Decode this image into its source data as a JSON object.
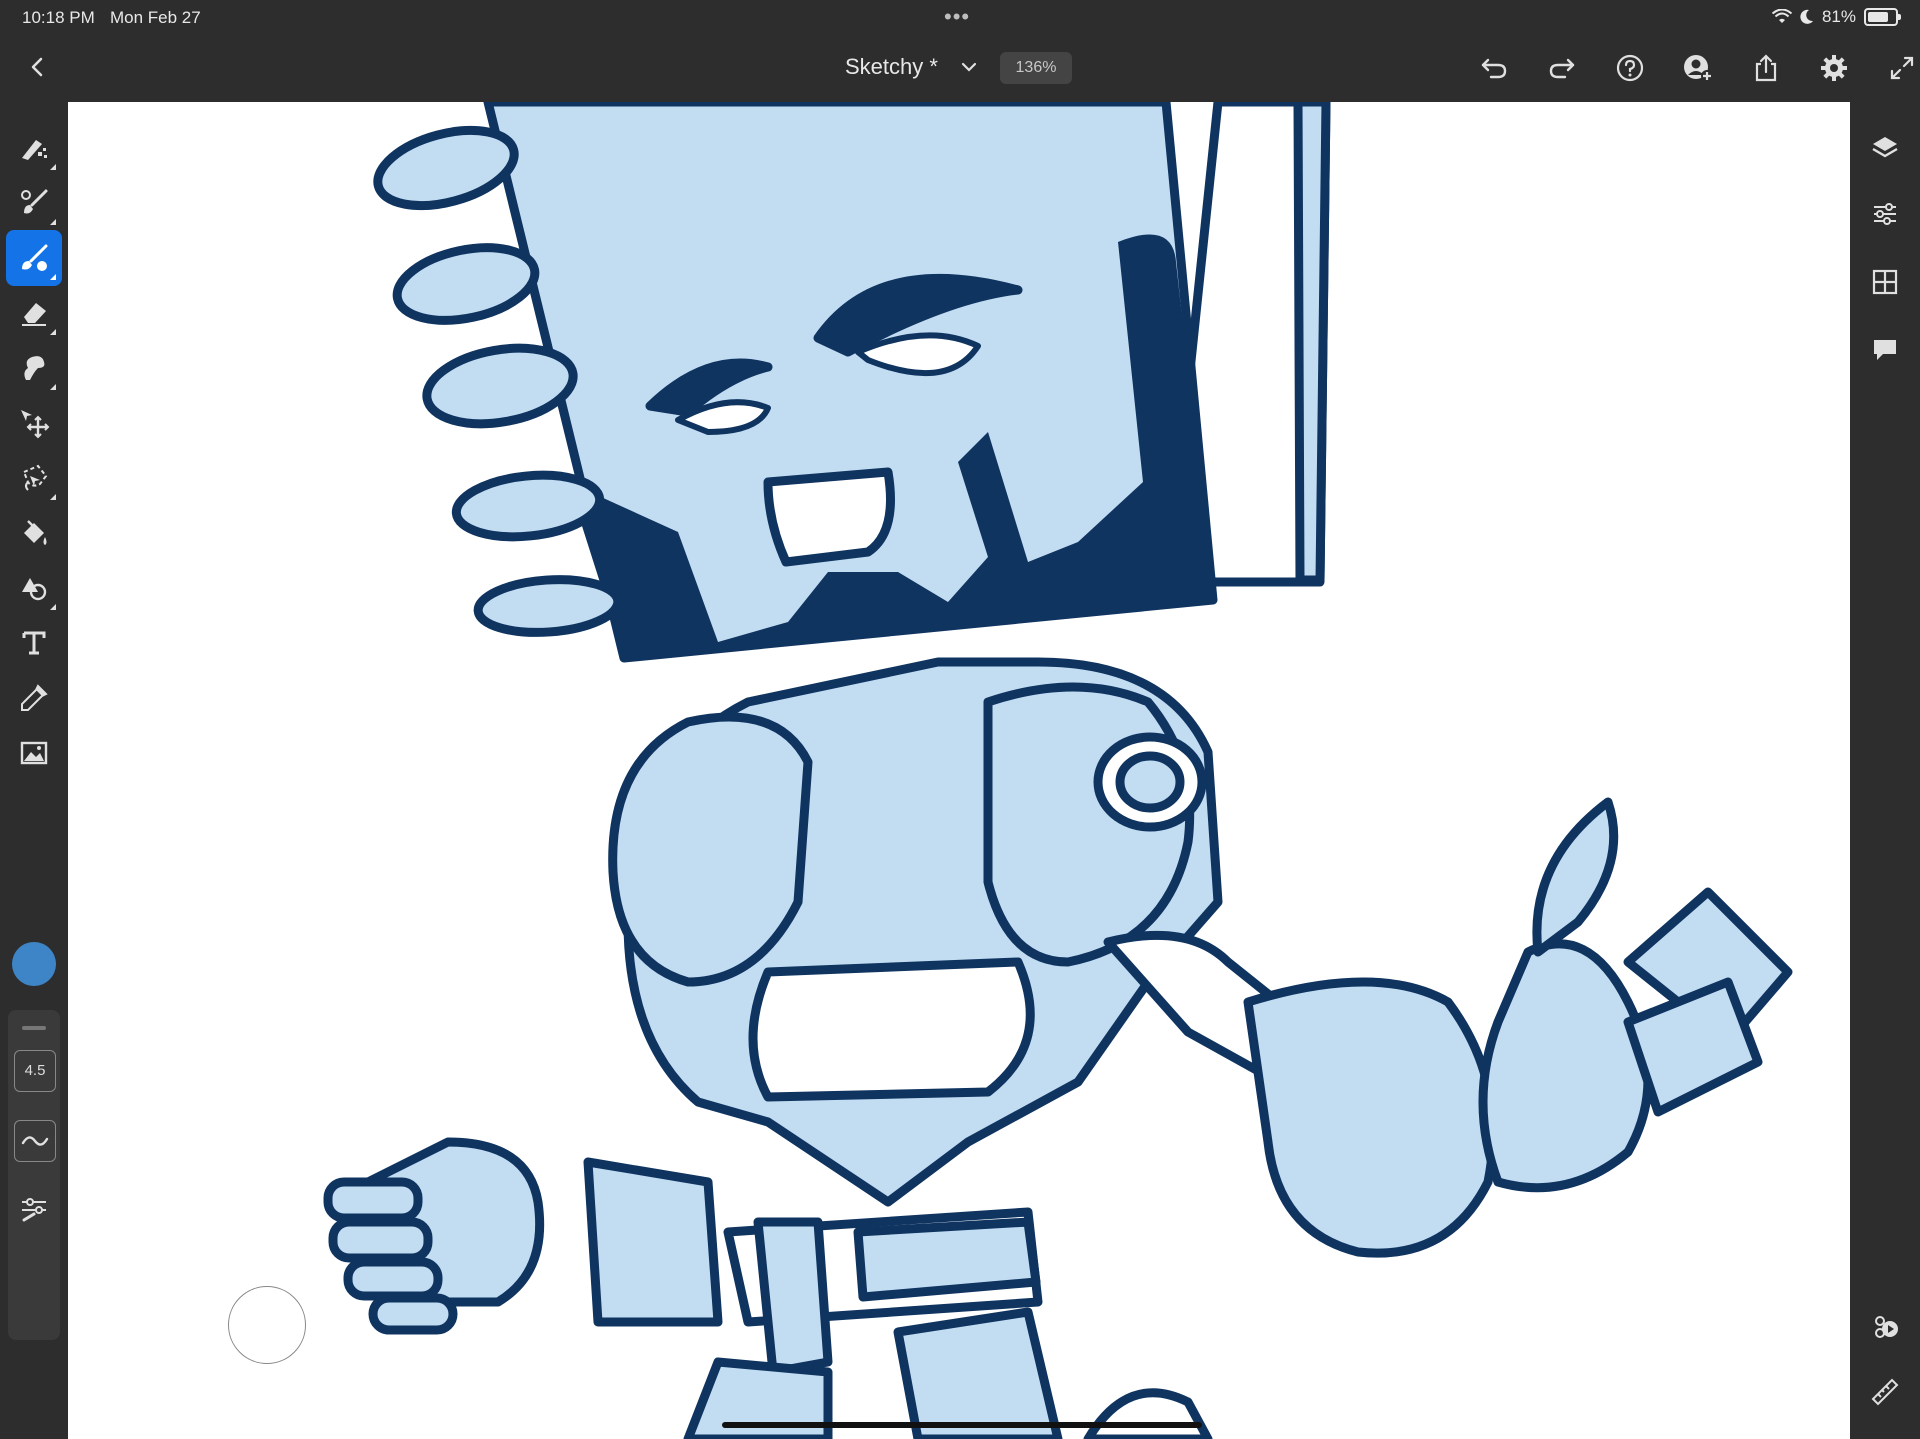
{
  "status": {
    "time": "10:18 PM",
    "date": "Mon Feb 27",
    "battery": "81%",
    "battery_level": 0.81
  },
  "header": {
    "title": "Sketchy *",
    "zoom": "136%"
  },
  "left_tools": [
    {
      "name": "pixel-brush",
      "icon": "pixel-brush-icon",
      "active": false
    },
    {
      "name": "live-brush",
      "icon": "live-brush-icon",
      "active": false
    },
    {
      "name": "vector-brush",
      "icon": "vector-brush-icon",
      "active": true
    },
    {
      "name": "eraser",
      "icon": "eraser-icon",
      "active": false
    },
    {
      "name": "smudge",
      "icon": "smudge-icon",
      "active": false
    },
    {
      "name": "transform",
      "icon": "transform-icon",
      "active": false
    },
    {
      "name": "selection",
      "icon": "lasso-icon",
      "active": false
    },
    {
      "name": "fill",
      "icon": "fill-bucket-icon",
      "active": false
    },
    {
      "name": "shapes",
      "icon": "shapes-icon",
      "active": false
    },
    {
      "name": "text",
      "icon": "text-icon",
      "active": false
    },
    {
      "name": "eyedropper",
      "icon": "eyedropper-icon",
      "active": false
    },
    {
      "name": "place-image",
      "icon": "image-icon",
      "active": false
    }
  ],
  "brush": {
    "size": "4.5",
    "color": "#3d85c6"
  },
  "colors": {
    "accent": "#1473e6",
    "ink": "#0f3460",
    "fill": "#c2dcf2"
  }
}
